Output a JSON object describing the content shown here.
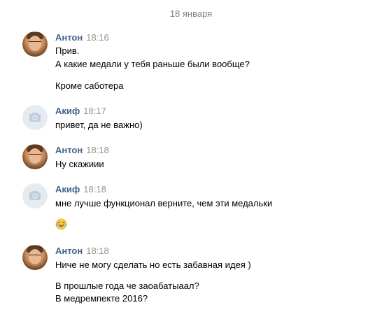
{
  "date_separator": "18 января",
  "colors": {
    "author": "#42648b",
    "time": "#939393",
    "text": "#000000",
    "date": "#828282",
    "default_avatar_bg": "#e5ebf1"
  },
  "messages": [
    {
      "author": "Антон",
      "time": "18:16",
      "avatar": "user-photo-avatar",
      "lines": [
        "Прив.",
        "А какие медали у тебя раньше были вообще?",
        "Кроме саботера"
      ]
    },
    {
      "author": "Акиф",
      "time": "18:17",
      "avatar": "camera-icon",
      "lines": [
        "привет, да не важно)"
      ]
    },
    {
      "author": "Антон",
      "time": "18:18",
      "avatar": "user-photo-avatar",
      "lines": [
        "Ну скажиии"
      ]
    },
    {
      "author": "Акиф",
      "time": "18:18",
      "avatar": "camera-icon",
      "lines": [
        "мне лучше функционал верните, чем эти медальки"
      ],
      "emoji": "laughing-tears-emoji"
    },
    {
      "author": "Антон",
      "time": "18:18",
      "avatar": "user-photo-avatar",
      "lines": [
        "Ниче не могу сделать но есть забавная идея )",
        "В прошлые года че заоабатыаал?",
        "В медремпекте 2016?"
      ]
    }
  ]
}
